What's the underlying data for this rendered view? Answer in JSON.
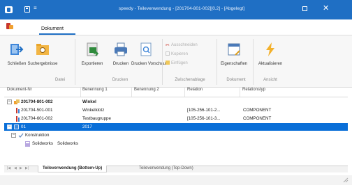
{
  "window": {
    "title": "speedy - Teileverwendung - [201704-801-002][0.2] - [Abgelegt]",
    "quick_access_more": "≡"
  },
  "ribbon_tabs": {
    "active": "Dokument"
  },
  "ribbon": {
    "groups": [
      {
        "label": "Datei",
        "buttons": [
          "Schließen",
          "Suchergebnisse"
        ]
      },
      {
        "label": "Drucken",
        "buttons": [
          "Exportieren",
          "Drucken",
          "Drucken Vorschau"
        ]
      },
      {
        "label": "Zwischenablage",
        "buttons": [
          "Ausschneiden",
          "Kopieren",
          "Einfügen"
        ]
      },
      {
        "label": "Dokument",
        "buttons": [
          "Eigenschaften"
        ]
      },
      {
        "label": "Ansicht",
        "buttons": [
          "Aktualisieren"
        ]
      }
    ]
  },
  "grid": {
    "columns": [
      "Dokument-Nr",
      "Benennung 1",
      "Benennung 2",
      "Relation",
      "Relationstyp"
    ],
    "rows": [
      {
        "nr": "201704-801-002",
        "ben1": "Winkel",
        "ben2": "",
        "relation": "",
        "reltyp": ""
      },
      {
        "nr": "201704-501-001",
        "ben1": "Winkelklotz",
        "ben2": "",
        "relation": "[105-256-101-2...",
        "reltyp": "COMPONENT"
      },
      {
        "nr": "201704-601-002",
        "ben1": "Testbaugruppe",
        "ben2": "",
        "relation": "[105-256-101-3...",
        "reltyp": "COMPONENT"
      },
      {
        "nr": "01",
        "ben1": "2017",
        "ben2": "",
        "relation": "",
        "reltyp": ""
      },
      {
        "nr": "Konstruktion",
        "ben1": "",
        "ben2": "",
        "relation": "",
        "reltyp": ""
      },
      {
        "nr": "Solidworks",
        "ben1": "Solidworks",
        "ben2": "",
        "relation": "",
        "reltyp": ""
      }
    ]
  },
  "bottom_tabs": [
    "Teileverwendung (Bottom-Up)",
    "Teileverwendung (Top-Down)"
  ],
  "colors": {
    "accent": "#1f6fc4",
    "selection": "#0a6fd8"
  }
}
